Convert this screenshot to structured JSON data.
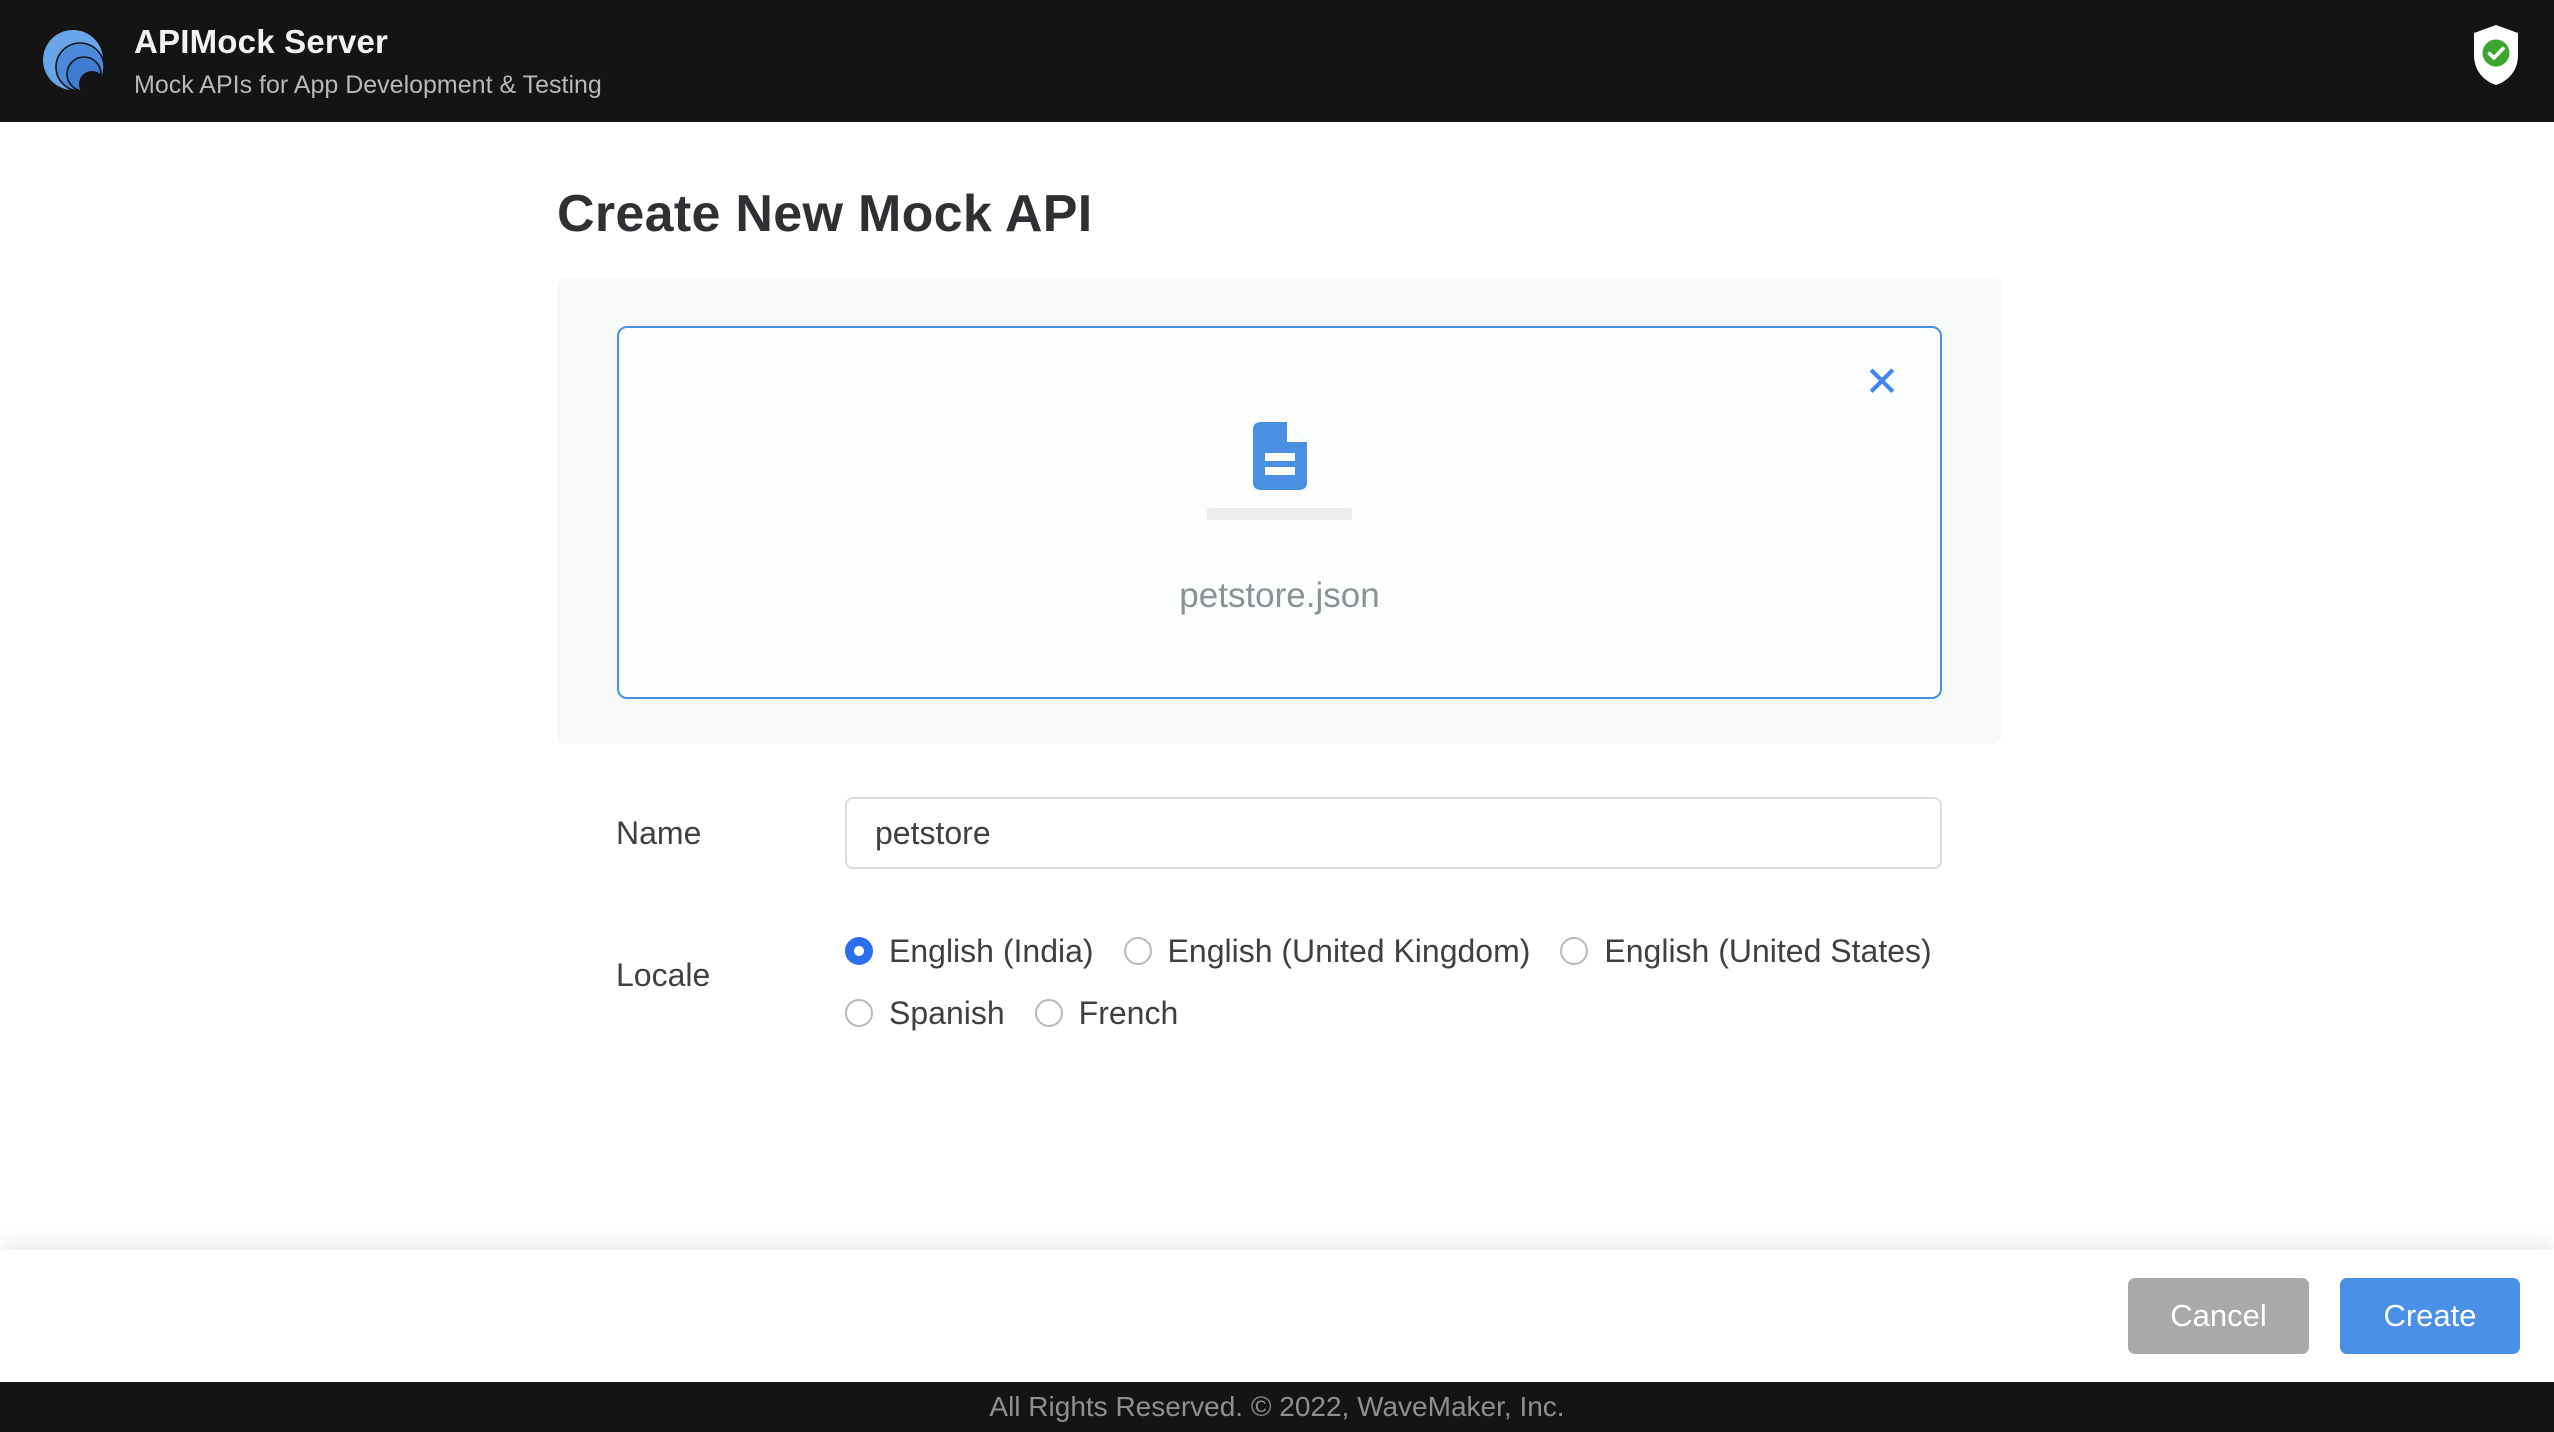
{
  "header": {
    "title": "APIMock Server",
    "subtitle": "Mock APIs for App Development & Testing"
  },
  "page": {
    "title": "Create New Mock API"
  },
  "upload": {
    "filename": "petstore.json"
  },
  "form": {
    "name_label": "Name",
    "name_value": "petstore",
    "locale_label": "Locale",
    "locales": [
      {
        "label": "English (India)",
        "selected": true
      },
      {
        "label": "English (United Kingdom)",
        "selected": false
      },
      {
        "label": "English (United States)",
        "selected": false
      },
      {
        "label": "Spanish",
        "selected": false
      },
      {
        "label": "French",
        "selected": false
      }
    ]
  },
  "footer": {
    "cancel_label": "Cancel",
    "create_label": "Create",
    "copyright": "All Rights Reserved. © 2022, WaveMaker, Inc."
  },
  "icons": {
    "close": "✕"
  },
  "colors": {
    "header_bg": "#141414",
    "accent_blue": "#4a90e2",
    "radio_blue": "#2b6ff0",
    "button_blue": "#4a8fe8",
    "button_gray": "#a9a9a9",
    "success_green": "#3aa52f"
  }
}
